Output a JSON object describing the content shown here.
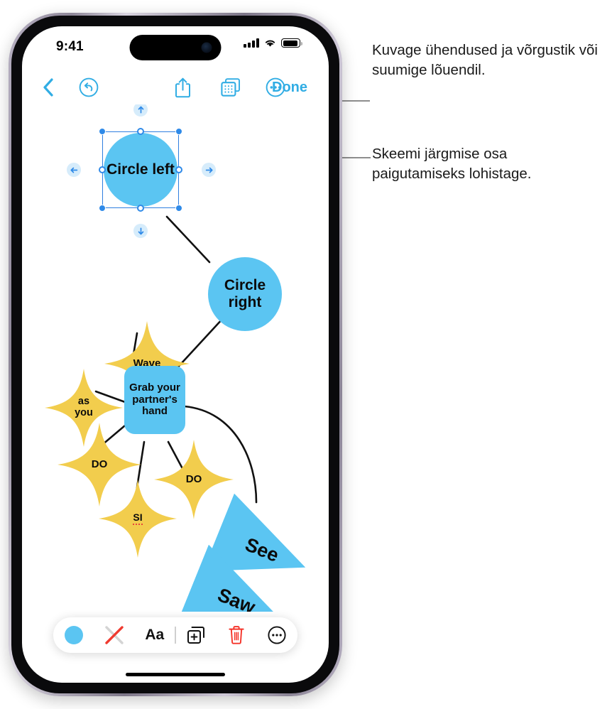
{
  "status_bar": {
    "time": "9:41",
    "signal_icon": "cellular-bars-icon",
    "wifi_icon": "wifi-icon",
    "battery_icon": "battery-icon"
  },
  "toolbar": {
    "back_icon": "chevron-left-icon",
    "undo_icon": "undo-circle-icon",
    "share_icon": "share-up-icon",
    "grid_icon": "connections-grid-icon",
    "more_icon": "ellipsis-circle-icon",
    "done_label": "Done"
  },
  "canvas": {
    "nodes": [
      {
        "id": "circle-left",
        "label": "Circle left",
        "shape": "circle",
        "color": "#5bc5f2",
        "selected": true
      },
      {
        "id": "circle-right",
        "label": "Circle right",
        "shape": "circle",
        "color": "#5bc5f2"
      },
      {
        "id": "wave",
        "label": "Wave",
        "shape": "4-point-star",
        "color": "#f2cd4d"
      },
      {
        "id": "as-you",
        "label": "as you",
        "shape": "4-point-star",
        "color": "#f2cd4d"
      },
      {
        "id": "grab-hand",
        "label": "Grab your partner's hand",
        "shape": "rounded-rect",
        "color": "#5bc5f2"
      },
      {
        "id": "do-left",
        "label": "DO",
        "shape": "4-point-star",
        "color": "#f2cd4d"
      },
      {
        "id": "do-right",
        "label": "DO",
        "shape": "4-point-star",
        "color": "#f2cd4d"
      },
      {
        "id": "si",
        "label": "SI",
        "shape": "4-point-star",
        "color": "#f2cd4d",
        "misspelled": true
      },
      {
        "id": "see",
        "label": "See",
        "shape": "triangle",
        "color": "#5bc5f2"
      },
      {
        "id": "saw",
        "label": "Saw",
        "shape": "triangle",
        "color": "#5bc5f2"
      }
    ],
    "selection": {
      "target": "circle-left",
      "handle_count": 8,
      "direction_buttons": [
        "up",
        "left",
        "right",
        "down"
      ]
    }
  },
  "bottom_toolbar": {
    "fill_color": "#5bc5f2",
    "fill_icon": "fill-color-swatch",
    "stroke_icon": "no-stroke-icon",
    "text_label": "Aa",
    "duplicate_icon": "duplicate-shape-icon",
    "delete_icon": "trash-icon",
    "more_icon": "ellipsis-circle-icon"
  },
  "callouts": [
    {
      "id": "callout-grid",
      "text": "Kuvage ühendused ja võrgustik või suumige lõuendil."
    },
    {
      "id": "callout-drag",
      "text": "Skeemi järgmise osa paigutamiseks lohistage."
    }
  ],
  "colors": {
    "accent_blue": "#31ade4",
    "shape_blue": "#5bc5f2",
    "shape_yellow": "#f2cd4d",
    "delete_red": "#f5342a",
    "selection_blue": "#2f8ae8",
    "leader_gray": "#8e8e8e"
  }
}
